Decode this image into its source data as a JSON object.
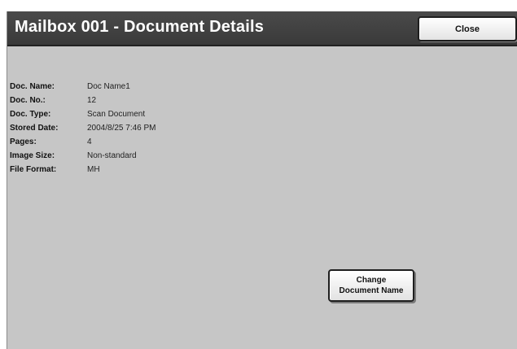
{
  "window": {
    "title": "Mailbox 001 - Document Details",
    "close_label": "Close"
  },
  "details": [
    {
      "label": "Doc. Name:",
      "value": "Doc Name1"
    },
    {
      "label": "Doc. No.:",
      "value": "12"
    },
    {
      "label": "Doc. Type:",
      "value": "Scan Document"
    },
    {
      "label": "Stored Date:",
      "value": "2004/8/25 7:46 PM"
    },
    {
      "label": "Pages:",
      "value": "4"
    },
    {
      "label": "Image Size:",
      "value": "Non-standard"
    },
    {
      "label": "File Format:",
      "value": "MH"
    }
  ],
  "actions": {
    "change_name_line1": "Change",
    "change_name_line2": "Document Name"
  },
  "colors": {
    "panel_background": "#c6c6c6",
    "title_bar": "#414141",
    "button_face": "#f2f2f2"
  }
}
